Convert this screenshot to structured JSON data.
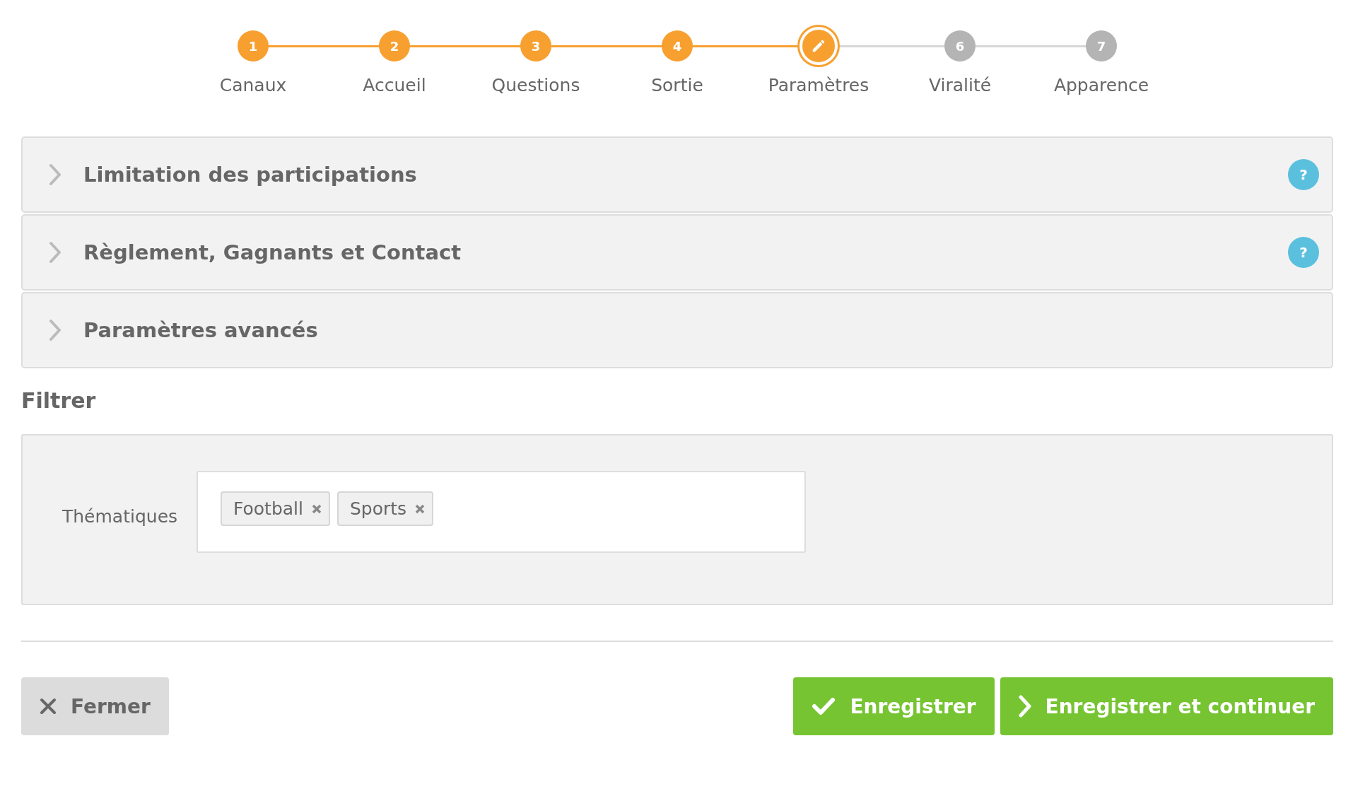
{
  "steps": [
    {
      "number": "1",
      "label": "Canaux",
      "done": true,
      "selected": false
    },
    {
      "number": "2",
      "label": "Accueil",
      "done": true,
      "selected": false
    },
    {
      "number": "3",
      "label": "Questions",
      "done": true,
      "selected": false
    },
    {
      "number": "4",
      "label": "Sortie",
      "done": true,
      "selected": false
    },
    {
      "label": "Paramètres",
      "done": false,
      "selected": true
    },
    {
      "number": "6",
      "label": "Viralité",
      "done": false,
      "selected": false
    },
    {
      "number": "7",
      "label": "Apparence",
      "done": false,
      "selected": false
    }
  ],
  "accordion": [
    {
      "title": "Limitation des participations",
      "expanded": false,
      "help": "?"
    },
    {
      "title": "Règlement, Gagnants et Contact",
      "expanded": false,
      "help": "?"
    },
    {
      "title": "Paramètres avancés",
      "expanded": false
    }
  ],
  "filter": {
    "title": "Filtrer",
    "field_label": "Thématiques",
    "tags": [
      {
        "label": "Football"
      },
      {
        "label": "Sports"
      }
    ]
  },
  "buttons": [
    {
      "kind": "close",
      "label": "Fermer"
    },
    {
      "kind": "save",
      "label": "Enregistrer"
    },
    {
      "kind": "next",
      "label": "Enregistrer et continuer"
    }
  ]
}
